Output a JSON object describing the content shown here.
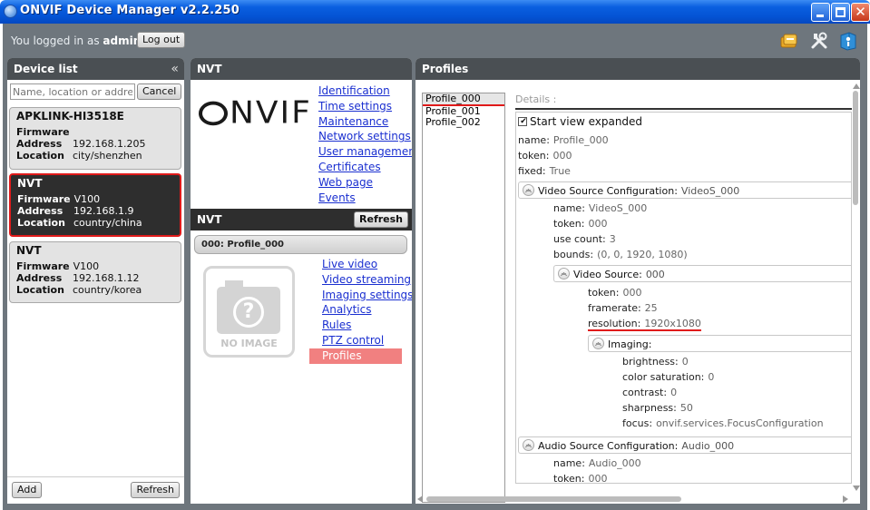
{
  "window": {
    "title": "ONVIF Device Manager v2.2.250"
  },
  "userbar": {
    "logged_in_prefix": "You logged in as",
    "username": "admin",
    "logout_label": "Log out",
    "tools": [
      "event-icon",
      "settings-wrench-icon",
      "help-icon"
    ]
  },
  "device_list": {
    "title": "Device list",
    "collapse_glyph": "«",
    "search_placeholder": "Name, location or address",
    "cancel_label": "Cancel",
    "devices": [
      {
        "name": "APKLINK-HI3518E",
        "firmware": "",
        "address": "192.168.1.205",
        "location": "city/shenzhen",
        "selected": false
      },
      {
        "name": "NVT",
        "firmware": "V100",
        "address": "192.168.1.9",
        "location": "country/china",
        "selected": true
      },
      {
        "name": "NVT",
        "firmware": "V100",
        "address": "192.168.1.12",
        "location": "country/korea",
        "selected": false
      }
    ],
    "labels": {
      "firmware": "Firmware",
      "address": "Address",
      "location": "Location"
    },
    "add_label": "Add",
    "refresh_label": "Refresh"
  },
  "nvt": {
    "title": "NVT",
    "logo_text": "NVIF",
    "device_links": [
      "Identification",
      "Time settings",
      "Maintenance",
      "Network settings",
      "User management",
      "Certificates",
      "Web page",
      "Events"
    ],
    "sub_title": "NVT",
    "refresh_label": "Refresh",
    "profile_tab": "000: Profile_000",
    "no_image_label": "NO IMAGE",
    "profile_links": [
      "Live video",
      "Video streaming",
      "Imaging settings",
      "Analytics",
      "Rules",
      "PTZ control",
      "Profiles"
    ],
    "active_link": "Profiles"
  },
  "profiles": {
    "title": "Profiles",
    "list": [
      "Profile_000",
      "Profile_001",
      "Profile_002"
    ],
    "selected": "Profile_000",
    "details_label": "Details :",
    "start_expanded_label": "Start view expanded",
    "start_expanded_checked": true,
    "fields": {
      "name": {
        "k": "name:",
        "v": "Profile_000"
      },
      "token": {
        "k": "token:",
        "v": "000"
      },
      "fixed": {
        "k": "fixed:",
        "v": "True"
      }
    },
    "video_source_config": {
      "label": "Video Source Configuration:",
      "value": "VideoS_000",
      "name": {
        "k": "name:",
        "v": "VideoS_000"
      },
      "token": {
        "k": "token:",
        "v": "000"
      },
      "use_count": {
        "k": "use count:",
        "v": "3"
      },
      "bounds": {
        "k": "bounds:",
        "v": "(0, 0, 1920, 1080)"
      }
    },
    "video_source": {
      "label": "Video Source:",
      "value": "000",
      "token": {
        "k": "token:",
        "v": "000"
      },
      "framerate": {
        "k": "framerate:",
        "v": "25"
      },
      "resolution": {
        "k": "resolution:",
        "v": "1920x1080"
      }
    },
    "imaging": {
      "label": "Imaging:",
      "brightness": {
        "k": "brightness:",
        "v": "0"
      },
      "color_saturation": {
        "k": "color saturation:",
        "v": "0"
      },
      "contrast": {
        "k": "contrast:",
        "v": "0"
      },
      "sharpness": {
        "k": "sharpness:",
        "v": "50"
      },
      "focus": {
        "k": "focus:",
        "v": "onvif.services.FocusConfiguration"
      }
    },
    "audio_source_config": {
      "label": "Audio Source Configuration:",
      "value": "Audio_000",
      "name": {
        "k": "name:",
        "v": "Audio_000"
      },
      "token": {
        "k": "token:",
        "v": "000"
      }
    }
  }
}
